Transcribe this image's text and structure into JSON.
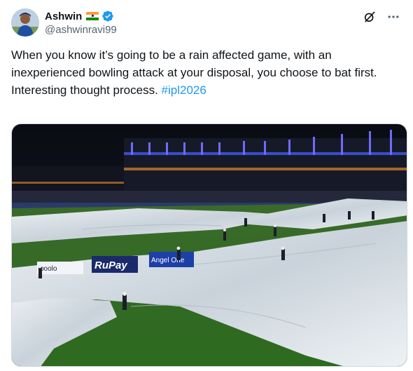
{
  "author": {
    "display_name": "Ashwin",
    "handle": "@ashwinravi99",
    "flag_icon": "india-flag-icon",
    "verified_icon": "verified-badge-icon",
    "verified_color": "#1d9bf0"
  },
  "post": {
    "line1": "When you know it’s going to be a rain affected game, with an",
    "line2": "inexperienced bowling attack at your disposal, you choose to bat first.",
    "line3_prefix": "Interesting thought process. ",
    "hashtag": "#ipl2026"
  },
  "media": {
    "ad_boards": [
      "poolo",
      "RuPay",
      "Angel One"
    ]
  },
  "actions": {
    "grok_icon": "grok-icon",
    "more_icon": "more-icon"
  },
  "colors": {
    "link": "#1d9bf0",
    "text": "#0f1419",
    "secondary": "#536471"
  }
}
